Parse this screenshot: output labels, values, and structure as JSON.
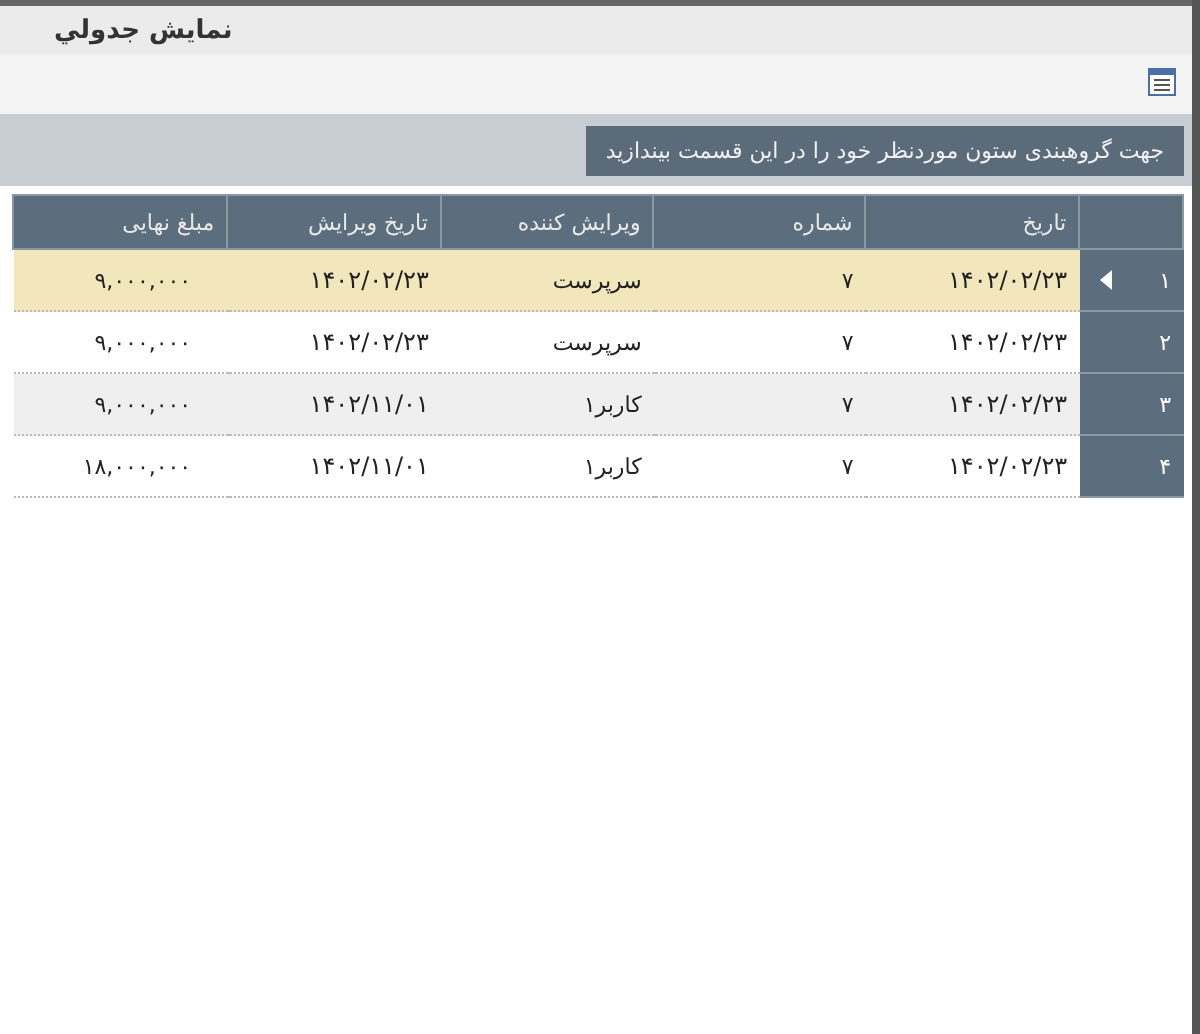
{
  "window": {
    "title": "نمایش جدولي"
  },
  "group_panel": {
    "hint": "جهت گروهبندی ستون موردنظر خود را در این قسمت بیندازید"
  },
  "table": {
    "columns": [
      "تاریخ",
      "شماره",
      "ویرایش کننده",
      "تاریخ ویرایش",
      "مبلغ نهایی"
    ],
    "rows": [
      {
        "row_number": "۱",
        "selected": true,
        "cells": [
          "۱۴۰۲/۰۲/۲۳",
          "۷",
          "سرپرست",
          "۱۴۰۲/۰۲/۲۳",
          "۹,۰۰۰,۰۰۰"
        ]
      },
      {
        "row_number": "۲",
        "selected": false,
        "cells": [
          "۱۴۰۲/۰۲/۲۳",
          "۷",
          "سرپرست",
          "۱۴۰۲/۰۲/۲۳",
          "۹,۰۰۰,۰۰۰"
        ]
      },
      {
        "row_number": "۳",
        "selected": false,
        "cells": [
          "۱۴۰۲/۰۲/۲۳",
          "۷",
          "کاربر۱",
          "۱۴۰۲/۱۱/۰۱",
          "۹,۰۰۰,۰۰۰"
        ]
      },
      {
        "row_number": "۴",
        "selected": false,
        "cells": [
          "۱۴۰۲/۰۲/۲۳",
          "۷",
          "کاربر۱",
          "۱۴۰۲/۱۱/۰۱",
          "۱۸,۰۰۰,۰۰۰"
        ]
      }
    ]
  }
}
